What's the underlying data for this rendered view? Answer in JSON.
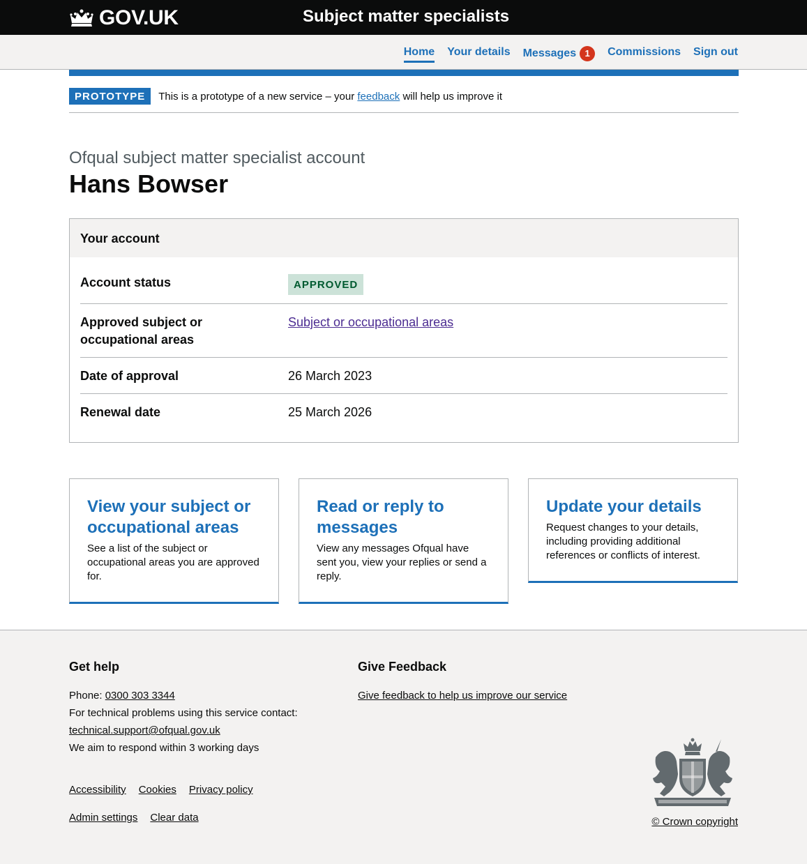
{
  "header": {
    "logo_text": "GOV.UK",
    "service_name": "Subject matter specialists"
  },
  "nav": {
    "items": [
      {
        "label": "Home",
        "active": true
      },
      {
        "label": "Your details"
      },
      {
        "label": "Messages",
        "badge": "1"
      },
      {
        "label": "Commissions"
      },
      {
        "label": "Sign out"
      }
    ]
  },
  "phase_banner": {
    "tag": "PROTOTYPE",
    "text_before": "This is a prototype of a new service – your ",
    "link": "feedback",
    "text_after": " will help us improve it"
  },
  "page": {
    "caption": "Ofqual subject matter specialist account",
    "title": "Hans Bowser"
  },
  "account": {
    "heading": "Your account",
    "rows": [
      {
        "key": "Account status",
        "value": "APPROVED"
      },
      {
        "key": "Approved subject or occupational areas",
        "value": "Subject or occupational areas"
      },
      {
        "key": "Date of approval",
        "value": "26 March 2023"
      },
      {
        "key": "Renewal date",
        "value": "25 March 2026"
      }
    ]
  },
  "cards": [
    {
      "title": "View your subject or occupational areas",
      "description": "See a list of the subject or occupational areas you are approved for."
    },
    {
      "title": "Read or reply to messages",
      "description": "View any messages Ofqual have sent you, view your replies or send a reply."
    },
    {
      "title": "Update your details",
      "description": "Request changes to your details, including providing additional references or conflicts of interest."
    }
  ],
  "footer": {
    "help": {
      "heading": "Get help",
      "phone_label": "Phone: ",
      "phone": "0300 303 3344",
      "tech_text": "For technical problems using this service contact:",
      "email": "technical.support@ofqual.gov.uk",
      "respond": "We aim to respond within 3 working days"
    },
    "feedback": {
      "heading": "Give Feedback",
      "link": "Give feedback to help us improve our service"
    },
    "links_row1": [
      "Accessibility",
      "Cookies",
      "Privacy policy"
    ],
    "links_row2": [
      "Admin settings",
      "Clear data"
    ],
    "copyright": "© Crown copyright"
  }
}
